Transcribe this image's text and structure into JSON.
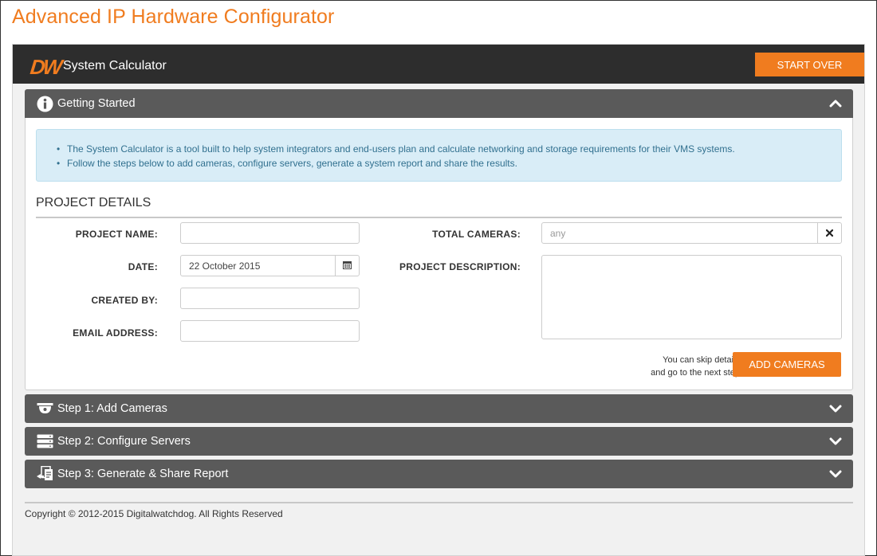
{
  "page": {
    "title": "Advanced IP Hardware Configurator"
  },
  "topbar": {
    "logo_text": "DW",
    "app_name": "System Calculator",
    "start_over_label": "START OVER"
  },
  "getting_started": {
    "title": "Getting Started",
    "info": [
      "The System Calculator is a tool built to help system integrators and end-users plan and calculate networking and storage requirements for their VMS systems.",
      "Follow the steps below to add cameras, configure servers, generate a system report and share the results."
    ]
  },
  "project_details": {
    "title": "PROJECT DETAILS",
    "project_name": {
      "label": "PROJECT NAME:",
      "value": ""
    },
    "date": {
      "label": "DATE:",
      "value": "22 October 2015"
    },
    "created_by": {
      "label": "CREATED BY:",
      "value": ""
    },
    "email": {
      "label": "EMAIL ADDRESS:",
      "value": ""
    },
    "total_cameras": {
      "label": "TOTAL CAMERAS:",
      "placeholder": "any"
    },
    "description": {
      "label": "PROJECT DESCRIPTION:",
      "value": ""
    },
    "skip_note": [
      "You can skip details",
      "and go to the next step"
    ],
    "add_cameras_label": "ADD CAMERAS"
  },
  "steps": [
    {
      "title": "Step 1: Add Cameras",
      "icon": "camera-dome-icon"
    },
    {
      "title": "Step 2: Configure Servers",
      "icon": "server-icon"
    },
    {
      "title": "Step 3: Generate & Share Report",
      "icon": "report-share-icon"
    }
  ],
  "footer": {
    "copyright": "Copyright © 2012-2015 Digitalwatchdog. All Rights Reserved"
  },
  "colors": {
    "accent": "#f07c1f",
    "topbar": "#2d2d2d",
    "panel_header": "#5a5a5a",
    "info_bg": "#d9edf7",
    "info_text": "#31708f"
  }
}
